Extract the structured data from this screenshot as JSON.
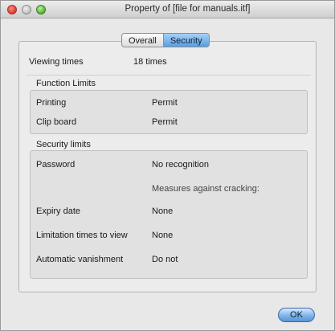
{
  "window": {
    "title": "Property of [file for manuals.itf]"
  },
  "tabs": [
    {
      "label": "Overall",
      "active": false
    },
    {
      "label": "Security",
      "active": true
    }
  ],
  "viewing": {
    "label": "Viewing times",
    "value": "18 times"
  },
  "function_limits": {
    "title": "Function Limits",
    "rows": [
      {
        "label": "Printing",
        "value": "Permit"
      },
      {
        "label": "Clip board",
        "value": "Permit"
      }
    ]
  },
  "security_limits": {
    "title": "Security limits",
    "password": {
      "label": "Password",
      "value": "No recognition",
      "note": "Measures against cracking:"
    },
    "rows": [
      {
        "label": "Expiry date",
        "value": "None"
      },
      {
        "label": "Limitation times to view",
        "value": "None"
      },
      {
        "label": "Automatic vanishment",
        "value": "Do not"
      }
    ]
  },
  "buttons": {
    "ok_label": "OK"
  },
  "colors": {
    "accent": "#5a9ee0"
  }
}
